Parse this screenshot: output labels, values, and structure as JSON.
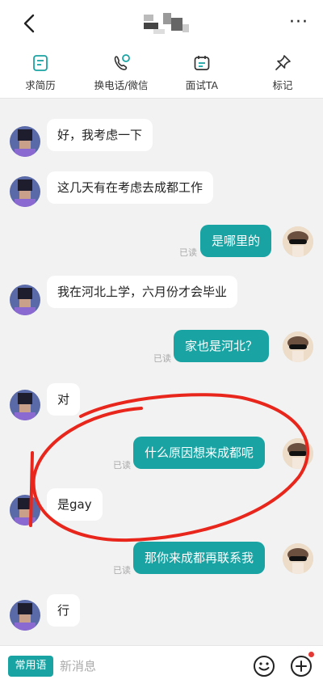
{
  "header": {
    "title": "",
    "more_label": "···"
  },
  "actions": [
    {
      "label": "求简历",
      "icon": "resume-icon"
    },
    {
      "label": "换电话/微信",
      "icon": "phone-wechat-icon"
    },
    {
      "label": "面试TA",
      "icon": "calendar-icon"
    },
    {
      "label": "标记",
      "icon": "pin-icon"
    }
  ],
  "messages": [
    {
      "side": "left",
      "text": "好，我考虑一下"
    },
    {
      "side": "left",
      "text": "这几天有在考虑去成都工作"
    },
    {
      "side": "right",
      "text": "是哪里的",
      "status": "已读"
    },
    {
      "side": "left",
      "text": "我在河北上学，六月份才会毕业"
    },
    {
      "side": "right",
      "text": "家也是河北？",
      "status": "已读"
    },
    {
      "side": "left",
      "text": "对"
    },
    {
      "side": "right",
      "text": "什么原因想来成都呢",
      "status": "已读"
    },
    {
      "side": "left",
      "text": "是gay"
    },
    {
      "side": "right",
      "text": "那你来成都再联系我",
      "status": "已读"
    },
    {
      "side": "left",
      "text": "行"
    }
  ],
  "composer": {
    "phrase_label": "常用语",
    "placeholder": "新消息"
  },
  "colors": {
    "accent": "#1aa3a3",
    "annotation": "#e8261c",
    "badge": "#e53935"
  }
}
